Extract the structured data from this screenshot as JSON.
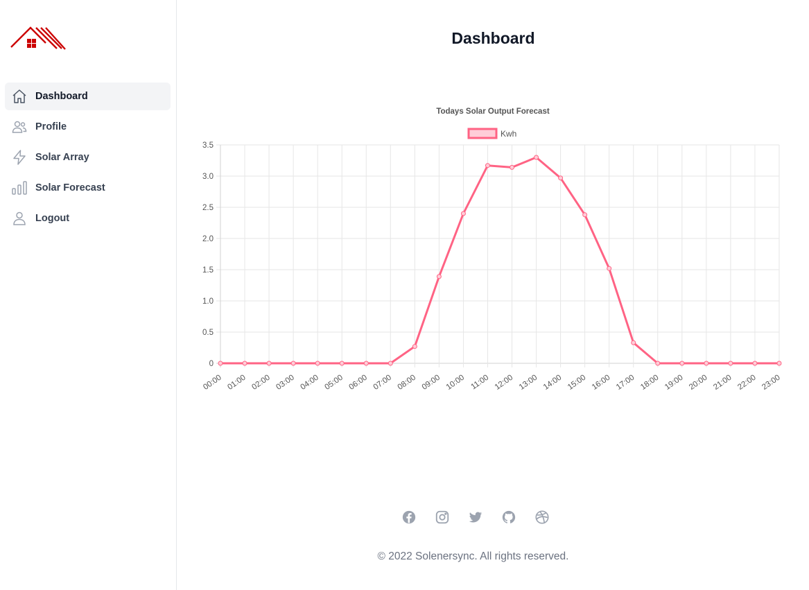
{
  "sidebar": {
    "items": [
      {
        "label": "Dashboard",
        "icon": "home-icon",
        "active": true
      },
      {
        "label": "Profile",
        "icon": "users-icon",
        "active": false
      },
      {
        "label": "Solar Array",
        "icon": "lightning-icon",
        "active": false
      },
      {
        "label": "Solar Forecast",
        "icon": "bar-chart-icon",
        "active": false
      },
      {
        "label": "Logout",
        "icon": "user-icon",
        "active": false
      }
    ]
  },
  "header": {
    "title": "Dashboard"
  },
  "colors": {
    "accent": "#cc0000",
    "series": "#ff6384",
    "series_fill": "#ffcdd8",
    "muted": "#6b7280"
  },
  "chart_data": {
    "type": "line",
    "title": "Todays Solar Output Forecast",
    "x": [
      "00:00",
      "01:00",
      "02:00",
      "03:00",
      "04:00",
      "05:00",
      "06:00",
      "07:00",
      "08:00",
      "09:00",
      "10:00",
      "11:00",
      "12:00",
      "13:00",
      "14:00",
      "15:00",
      "16:00",
      "17:00",
      "18:00",
      "19:00",
      "20:00",
      "21:00",
      "22:00",
      "23:00"
    ],
    "series": [
      {
        "name": "Kwh",
        "values": [
          0,
          0,
          0,
          0,
          0,
          0,
          0,
          0,
          0.27,
          1.39,
          2.4,
          3.17,
          3.14,
          3.3,
          2.97,
          2.38,
          1.52,
          0.33,
          0,
          0,
          0,
          0,
          0,
          0
        ]
      }
    ],
    "yticks": [
      "0",
      "0.5",
      "1.0",
      "1.5",
      "2.0",
      "2.5",
      "3.0",
      "3.5"
    ],
    "ylim": [
      0,
      3.5
    ],
    "grid": true,
    "legend": "top"
  },
  "footer": {
    "social": [
      "facebook-icon",
      "instagram-icon",
      "twitter-icon",
      "github-icon",
      "dribbble-icon"
    ],
    "copyright": "© 2022 Solenersync. All rights reserved."
  }
}
